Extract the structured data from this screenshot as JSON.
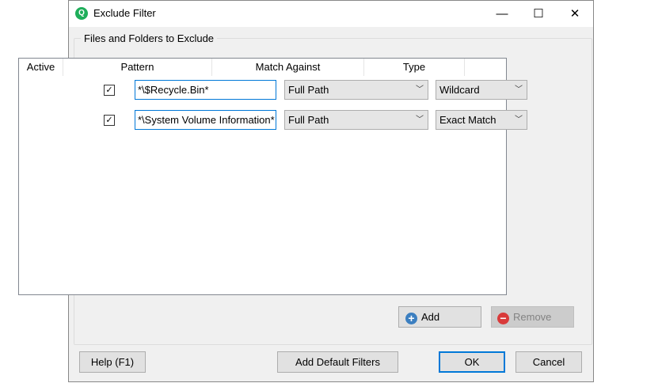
{
  "window": {
    "title": "Exclude Filter",
    "minimize": "—",
    "maximize": "☐",
    "close": "✕"
  },
  "group": {
    "label": "Files and Folders to Exclude"
  },
  "columns": [
    "Active",
    "Pattern",
    "Match Against",
    "Type"
  ],
  "rows": [
    {
      "active": true,
      "pattern": "*\\$Recycle.Bin*",
      "match": "Full Path",
      "type": "Wildcard"
    },
    {
      "active": true,
      "pattern": "*\\System Volume Information*",
      "match": "Full Path",
      "type": "Exact Match"
    }
  ],
  "buttons": {
    "add": "Add",
    "remove": "Remove",
    "help": "Help (F1)",
    "add_defaults": "Add Default Filters",
    "ok": "OK",
    "cancel": "Cancel"
  },
  "check_glyph": "✓"
}
